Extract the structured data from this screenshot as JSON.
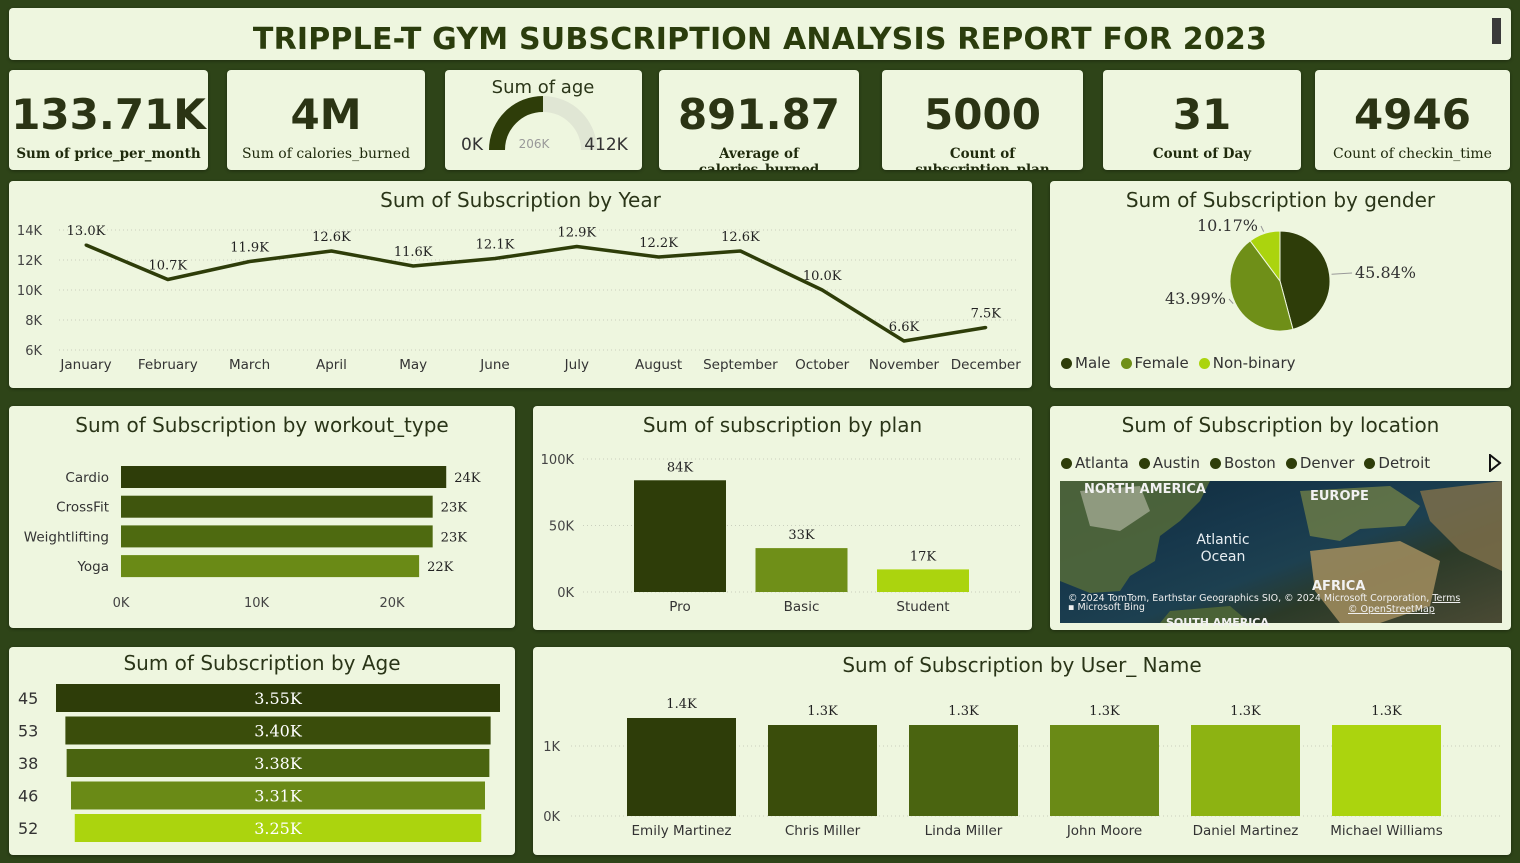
{
  "header": {
    "title": "TRIPPLE-T GYM SUBSCRIPTION ANALYSIS REPORT FOR 2023"
  },
  "kpis": [
    {
      "value": "133.71K",
      "label": "Sum of price_per_month"
    },
    {
      "value": "4M",
      "label": "Sum of calories_burned"
    },
    {
      "value": "891.87",
      "label": "Average of calories_burned"
    },
    {
      "value": "5000",
      "label": "Count of subscription_plan"
    },
    {
      "value": "31",
      "label": "Count of Day"
    },
    {
      "value": "4946",
      "label": "Count of checkin_time"
    }
  ],
  "gauge": {
    "title": "Sum of age",
    "min_label": "0K",
    "max_label": "412K",
    "value_label": "206K",
    "value": 206,
    "min": 0,
    "max": 412
  },
  "colors": {
    "dark": "#2e3d09",
    "mid": "#4a6410",
    "olive": "#6f8f18",
    "lime": "#abd40e",
    "bg": "#eef6df",
    "outer": "#2e4418"
  },
  "chart_data": [
    {
      "id": "by_year",
      "type": "line",
      "title": "Sum of Subscription by Year",
      "categories": [
        "January",
        "February",
        "March",
        "April",
        "May",
        "June",
        "July",
        "August",
        "September",
        "October",
        "November",
        "December"
      ],
      "values": [
        13.0,
        10.7,
        11.9,
        12.6,
        11.6,
        12.1,
        12.9,
        12.2,
        12.6,
        10.0,
        6.6,
        7.5
      ],
      "value_labels": [
        "13.0K",
        "10.7K",
        "11.9K",
        "12.6K",
        "11.6K",
        "12.1K",
        "12.9K",
        "12.2K",
        "12.6K",
        "10.0K",
        "6.6K",
        "7.5K"
      ],
      "yticks": [
        "6K",
        "8K",
        "10K",
        "12K",
        "14K"
      ],
      "ylim": [
        6,
        14
      ]
    },
    {
      "id": "by_gender",
      "type": "pie",
      "title": "Sum of Subscription by gender",
      "labels": [
        "Male",
        "Female",
        "Non-binary"
      ],
      "values": [
        45.84,
        43.99,
        10.17
      ],
      "value_labels": [
        "45.84%",
        "43.99%",
        "10.17%"
      ],
      "colors": [
        "#2e3d09",
        "#6f8f18",
        "#abd40e"
      ],
      "legend": "bottom"
    },
    {
      "id": "by_workout",
      "type": "bar",
      "orientation": "horizontal",
      "title": "Sum of Subscription by workout_type",
      "categories": [
        "Cardio",
        "CrossFit",
        "Weightlifting",
        "Yoga"
      ],
      "values": [
        24,
        23,
        23,
        22
      ],
      "value_labels": [
        "24K",
        "23K",
        "23K",
        "22K"
      ],
      "xticks": [
        "0K",
        "10K",
        "20K"
      ],
      "xlim": [
        0,
        24.5
      ],
      "colors": [
        "#2e3d09",
        "#3f550d",
        "#4e6a10",
        "#6a8a16"
      ]
    },
    {
      "id": "by_plan",
      "type": "bar",
      "title": "Sum of subscription by plan",
      "categories": [
        "Pro",
        "Basic",
        "Student"
      ],
      "values": [
        84,
        33,
        17
      ],
      "value_labels": [
        "84K",
        "33K",
        "17K"
      ],
      "yticks": [
        "0K",
        "50K",
        "100K"
      ],
      "ylim": [
        0,
        100
      ],
      "colors": [
        "#2e3d09",
        "#6f8f18",
        "#abd40e"
      ]
    },
    {
      "id": "by_location",
      "type": "map",
      "title": "Sum of Subscription by location",
      "legend": [
        "Atlanta",
        "Austin",
        "Boston",
        "Denver",
        "Detroit"
      ]
    },
    {
      "id": "by_age",
      "type": "bar",
      "orientation": "horizontal",
      "title": "Sum of Subscription by Age",
      "categories": [
        "45",
        "53",
        "38",
        "46",
        "52"
      ],
      "values": [
        3.55,
        3.4,
        3.38,
        3.31,
        3.25
      ],
      "value_labels": [
        "3.55K",
        "3.40K",
        "3.38K",
        "3.31K",
        "3.25K"
      ],
      "colors": [
        "#2e3d09",
        "#3a4d0b",
        "#4a6410",
        "#6a8a16",
        "#abd40e"
      ]
    },
    {
      "id": "by_user",
      "type": "bar",
      "title": "Sum of Subscription by User_ Name",
      "categories": [
        "Emily Martinez",
        "Chris Miller",
        "Linda Miller",
        "John Moore",
        "Daniel Martinez",
        "Michael Williams"
      ],
      "values": [
        1.4,
        1.3,
        1.3,
        1.3,
        1.3,
        1.3
      ],
      "value_labels": [
        "1.4K",
        "1.3K",
        "1.3K",
        "1.3K",
        "1.3K",
        "1.3K"
      ],
      "yticks": [
        "0K",
        "1K"
      ],
      "ylim": [
        0,
        1.4
      ],
      "colors": [
        "#2e3d09",
        "#3a4d0b",
        "#4a6410",
        "#6a8a16",
        "#8db312",
        "#abd40e"
      ]
    }
  ],
  "map": {
    "labels": [
      "NORTH AMERICA",
      "EUROPE",
      "AFRICA",
      "SOUTH AMERICA"
    ],
    "ocean": "Atlantic Ocean",
    "credit": "© 2024 TomTom, Earthstar Geographics SIO, © 2024 Microsoft Corporation,",
    "terms": "Terms",
    "osm": "© OpenStreetMap",
    "bing": "Microsoft Bing"
  }
}
